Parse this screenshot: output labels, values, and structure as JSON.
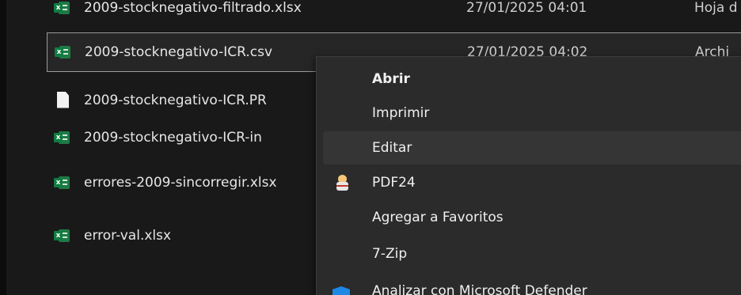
{
  "files": [
    {
      "name": "2009-stocknegativo-filtrado.xlsx",
      "date": "27/01/2025 04:01",
      "type": "Hoja d",
      "icon": "excel-icon"
    },
    {
      "name": "2009-stocknegativo-ICR.csv",
      "date": "27/01/2025 04:02",
      "type": "Archi",
      "icon": "excel-csv-icon"
    },
    {
      "name": "2009-stocknegativo-ICR.PR",
      "icon": "document-icon"
    },
    {
      "name": "2009-stocknegativo-ICR-in",
      "icon": "excel-icon"
    },
    {
      "name": "errores-2009-sincorregir.xlsx",
      "icon": "excel-icon"
    },
    {
      "name": "error-val.xlsx",
      "icon": "excel-icon"
    }
  ],
  "context_menu": {
    "items": [
      {
        "label": "Abrir",
        "bold": true
      },
      {
        "label": "Imprimir"
      },
      {
        "label": "Editar"
      },
      {
        "label": "PDF24",
        "icon": "pdf24-icon"
      },
      {
        "label": "Agregar a Favoritos"
      },
      {
        "label": "7-Zip"
      }
    ],
    "partial_item": {
      "label": "Analizar con Microsoft Defender",
      "icon": "defender-shield-icon"
    }
  },
  "colors": {
    "background": "#191919",
    "menu_background": "#2b2b2b",
    "selection_border": "#9a9a9a",
    "excel_green": "#107c41",
    "text": "#e6e6e6"
  }
}
